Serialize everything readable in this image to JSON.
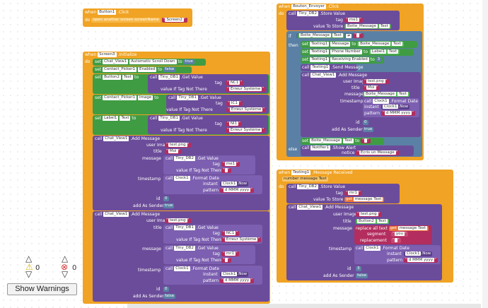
{
  "button1_event": {
    "when": "when",
    "component": "Button1",
    "event": ".Click",
    "do": "do",
    "call": "open another screen  screenName",
    "screen_value": "Screen2"
  },
  "screen3_event": {
    "when": "when",
    "component": "Screen3",
    "event": ".Initialize",
    "do": "do",
    "set1": {
      "set": "set",
      "comp": "Chat_View1",
      "prop": "Automatic Scroll Down",
      "to": "to",
      "value": "true"
    },
    "set2": {
      "set": "set",
      "comp": "Contact_Picker1",
      "prop": "Enabled",
      "to": "to",
      "value": "false"
    },
    "set3": {
      "set": "set",
      "comp": "Button2",
      "prop": "Text",
      "to": "to",
      "call": "call",
      "db": "Tiny_DB1",
      "method": ".Get Value",
      "tag": "tag",
      "tag_val": "NC1",
      "ifnot": "value If Tag Not There",
      "ifnot_val": "Erreur Système"
    },
    "set4": {
      "set": "set",
      "comp": "Contact_Picker1",
      "prop": "Image",
      "to": "to",
      "call": "call",
      "db": "Tiny_DB1",
      "method": ".Get Value",
      "tag": "tag",
      "tag_val": "IC1",
      "ifnot": "value If Tag Not There",
      "ifnot_val": "Erreur Système"
    },
    "set5": {
      "set": "set",
      "comp": "Label1",
      "prop": "Text",
      "to": "to",
      "call": "call",
      "db": "Tiny_DB1",
      "method": ".Get Value",
      "tag": "tag",
      "tag_val": "NI1",
      "ifnot": "value If Tag Not There",
      "ifnot_val": "Erreur Système"
    },
    "msg1": {
      "call": "call",
      "comp": "Chat_View1",
      "method": ".Add Message",
      "user_image": "user Image",
      "user_image_val": "test.png",
      "title": "title",
      "title_val": "Moi",
      "message": "message",
      "db": "Tiny_DB2",
      "db_method": ".Get Value",
      "tag": "tag",
      "tag_val": "me1",
      "ifnot": "value If Tag Not There",
      "ifnot_val": "",
      "timestamp": "timestamp",
      "clock": "Clock1",
      "clock_method": ".Format Date",
      "instant": "instant",
      "now": ".Now",
      "pattern": "pattern",
      "pattern_val": "d MMM yyyy",
      "id": "id",
      "id_val": "0",
      "add_sender": "add As Sender",
      "add_sender_val": "true"
    },
    "msg2": {
      "call": "call",
      "comp": "Chat_View1",
      "method": ".Add Message",
      "user_image": "user Image",
      "user_image_val": "test.png",
      "title": "title",
      "db1": "Tiny_DB1",
      "db1_method": ".Get Value",
      "tag1": "tag",
      "tag1_val": "NC1",
      "ifnot1": "value If Tag Not There",
      "ifnot1_val": "Erreur Système",
      "message": "message",
      "db2": "Tiny_DB2",
      "db2_method": ".Get Value",
      "tag2": "tag",
      "tag2_val": "mr1",
      "ifnot2": "value If Tag Not There",
      "ifnot2_val": "",
      "timestamp": "timestamp",
      "clock": "Clock1",
      "clock_method": ".Format Date",
      "instant": "instant",
      "now": ".Now",
      "pattern": "pattern",
      "pattern_val": "d MMM yyyy",
      "id": "id",
      "id_val": "0",
      "add_sender": "add As Sender",
      "add_sender_val": "false"
    }
  },
  "envoyer_event": {
    "when": "when",
    "component": "Bouton_Envoyer",
    "event": ".Click",
    "do": "do",
    "store": {
      "call": "call",
      "db": "Tiny_DB2",
      "method": ".Store Value",
      "tag": "tag",
      "tag_val": "me1",
      "store": "value To Store",
      "comp": "Boite_Message",
      "prop": "Text"
    },
    "if": {
      "if": "if",
      "then": "then",
      "else": "else",
      "comp": "Boite_Message",
      "prop": "Text",
      "op": "≠",
      "empty": ""
    },
    "then_rows": [
      {
        "set": "set",
        "comp": "Texting1",
        "prop": "Message",
        "to": "to",
        "src": "Boite_Message",
        "src_prop": "Text"
      },
      {
        "set": "set",
        "comp": "Texting1",
        "prop": "Phone Number",
        "to": "to",
        "src": "Label1",
        "src_prop": "Text"
      },
      {
        "set": "set",
        "comp": "Texting1",
        "prop": "Receiving Enabled",
        "to": "to",
        "val": "3"
      }
    ],
    "send": {
      "call": "call",
      "comp": "Texting1",
      "method": ".Send Message"
    },
    "add": {
      "call": "call",
      "comp": "Chat_View1",
      "method": ".Add Message",
      "user_image": "user Image",
      "user_image_val": "test.png",
      "title": "title",
      "title_val": "Moi",
      "message": "message",
      "msg_comp": "Boite_Message",
      "msg_prop": "Text",
      "timestamp": "timestamp",
      "clock": "Clock1",
      "clock_method": ".Format Date",
      "instant": "instant",
      "now": ".Now",
      "pattern": "pattern",
      "pattern_val": "d MMM yyyy",
      "id": "id",
      "id_val": "0",
      "add_sender": "add As Sender",
      "add_sender_val": "true"
    },
    "clear": {
      "set": "set",
      "comp": "Boite_Message",
      "prop": "Text",
      "to": "to",
      "val": ""
    },
    "else_row": {
      "call": "call",
      "comp": "Notifier1",
      "method": ".Show Alert",
      "notice": "notice",
      "notice_val": "Ecris un Message"
    }
  },
  "received_event": {
    "when": "when",
    "component": "Texting1",
    "event": ".Message Received",
    "params": "number   message Text",
    "do": "do",
    "store": {
      "call": "call",
      "db": "Tiny_DB2",
      "method": ".Store Value",
      "tag": "tag",
      "tag_val": "mr1",
      "store": "value To Store",
      "get": "get",
      "get_val": "message Text"
    },
    "add": {
      "call": "call",
      "comp": "Chat_View1",
      "method": ".Add Message",
      "user_image": "user Image",
      "user_image_val": "test.png",
      "title": "title",
      "title_comp": "Button2",
      "title_prop": "Text",
      "message": "message",
      "replace": "replace all text",
      "get": "get",
      "get_val": "message Text",
      "segment": "segment",
      "segment_val": "you",
      "replacement": "replacement",
      "replacement_val": "",
      "timestamp": "timestamp",
      "clock": "Clock1",
      "clock_method": ".Format Date",
      "instant": "instant",
      "now": ".Now",
      "pattern": "pattern",
      "pattern_val": "d MMM yyyy",
      "id": "id",
      "id_val": "3",
      "add_sender": "add As Sender",
      "add_sender_val": "false"
    }
  },
  "warnings": {
    "warn_count": "0",
    "error_count": "0",
    "show_label": "Show Warnings"
  },
  "colors": {
    "event": "#f0a324",
    "set_green": "#3f9c43",
    "call_purple": "#6b4c9a",
    "text_red": "#b32d5e",
    "logic_blue": "#5b80a5"
  }
}
